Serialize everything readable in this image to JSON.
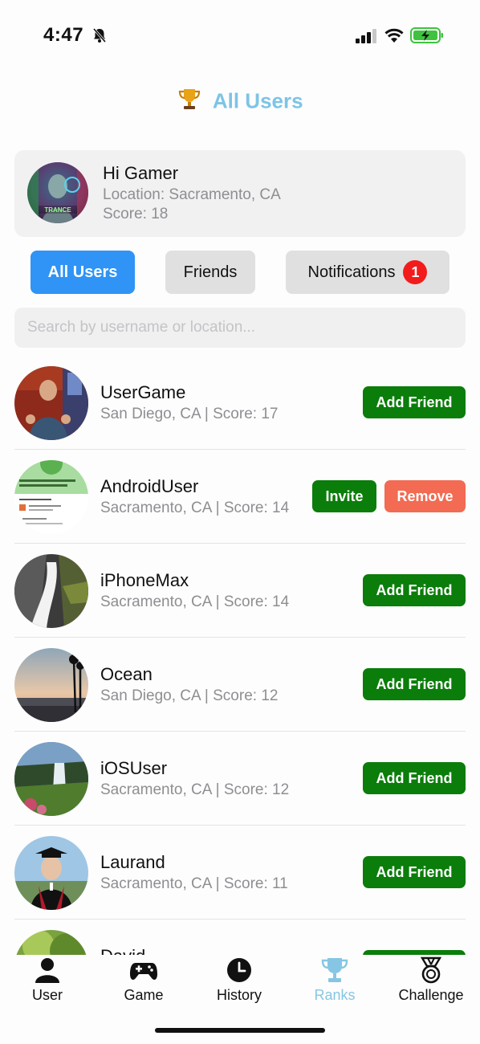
{
  "status_bar": {
    "time": "4:47"
  },
  "header": {
    "title": "All Users",
    "trophy": "🏆"
  },
  "profile": {
    "name": "Hi Gamer",
    "location": "Location: Sacramento, CA",
    "score": "Score: 18",
    "avatar_text": "TRANCE"
  },
  "tabs": {
    "all_users": "All Users",
    "friends": "Friends",
    "notifications": "Notifications",
    "notification_count": "1"
  },
  "search": {
    "placeholder": "Search by username or location..."
  },
  "users": [
    {
      "name": "UserGame",
      "meta": "San Diego, CA | Score: 17",
      "action": "Add Friend"
    },
    {
      "name": "AndroidUser",
      "meta": "Sacramento, CA | Score: 14",
      "invite": "Invite",
      "remove": "Remove"
    },
    {
      "name": "iPhoneMax",
      "meta": "Sacramento, CA | Score: 14",
      "action": "Add Friend"
    },
    {
      "name": "Ocean",
      "meta": "San Diego, CA | Score: 12",
      "action": "Add Friend"
    },
    {
      "name": "iOSUser",
      "meta": "Sacramento, CA | Score: 12",
      "action": "Add Friend"
    },
    {
      "name": "Laurand",
      "meta": "Sacramento, CA | Score: 11",
      "action": "Add Friend"
    },
    {
      "name": "David",
      "meta": "",
      "action": ""
    }
  ],
  "tab_bar": {
    "user": "User",
    "game": "Game",
    "history": "History",
    "ranks": "Ranks",
    "challenge": "Challenge"
  },
  "colors": {
    "accent_blue": "#2f94f5",
    "title_blue": "#7dc4e6",
    "add_green": "#0a7d0a",
    "remove_red": "#f26b52",
    "badge_red": "#f21c1c"
  }
}
